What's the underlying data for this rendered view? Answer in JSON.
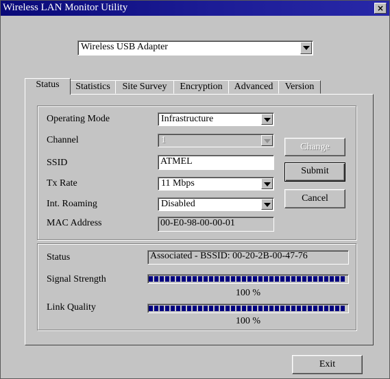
{
  "window": {
    "title": "Wireless LAN Monitor Utility",
    "close_label": "×"
  },
  "adapter_select": {
    "value": "Wireless USB Adapter"
  },
  "tabs": [
    {
      "label": "Status",
      "active": true
    },
    {
      "label": "Statistics",
      "active": false
    },
    {
      "label": "Site Survey",
      "active": false
    },
    {
      "label": "Encryption",
      "active": false
    },
    {
      "label": "Advanced",
      "active": false
    },
    {
      "label": "Version",
      "active": false
    }
  ],
  "config": {
    "operating_mode": {
      "label": "Operating Mode",
      "value": "Infrastructure"
    },
    "channel": {
      "label": "Channel",
      "value": "1"
    },
    "ssid": {
      "label": "SSID",
      "value": "ATMEL"
    },
    "tx_rate": {
      "label": "Tx Rate",
      "value": "11 Mbps"
    },
    "roaming": {
      "label": "Int. Roaming",
      "value": "Disabled"
    },
    "mac": {
      "label": "MAC Address",
      "value": "00-E0-98-00-00-01"
    }
  },
  "buttons": {
    "change": "Change",
    "submit": "Submit",
    "cancel": "Cancel",
    "exit": "Exit"
  },
  "status": {
    "status": {
      "label": "Status",
      "value": "Associated - BSSID: 00-20-2B-00-47-76"
    },
    "signal_strength": {
      "label": "Signal Strength",
      "percent": 100,
      "text": "100 %"
    },
    "link_quality": {
      "label": "Link Quality",
      "percent": 100,
      "text": "100 %"
    }
  },
  "colors": {
    "titlebar": "#0a0a78",
    "progress": "#000080",
    "face": "#c4c4c4"
  }
}
